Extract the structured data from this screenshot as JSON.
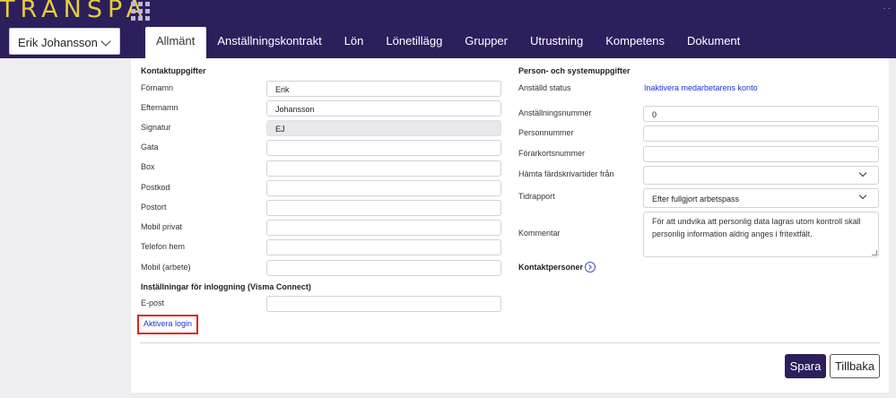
{
  "header": {
    "logo": "TRANSPA",
    "apps_icon": "grid-icon",
    "employee_select": "Erik Johansson"
  },
  "tabs": [
    {
      "label": "Allmänt",
      "active": true
    },
    {
      "label": "Anställningskontrakt"
    },
    {
      "label": "Lön"
    },
    {
      "label": "Lönetillägg"
    },
    {
      "label": "Grupper"
    },
    {
      "label": "Utrustning"
    },
    {
      "label": "Kompetens"
    },
    {
      "label": "Dokument"
    }
  ],
  "contact": {
    "heading": "Kontaktuppgifter",
    "fields": [
      {
        "label": "Förnamn",
        "value": "Erik"
      },
      {
        "label": "Efternamn",
        "value": "Johansson"
      },
      {
        "label": "Signatur",
        "value": "EJ"
      },
      {
        "label": "Gata",
        "value": ""
      },
      {
        "label": "Box",
        "value": ""
      },
      {
        "label": "Postkod",
        "value": ""
      },
      {
        "label": "Postort",
        "value": ""
      },
      {
        "label": "Mobil privat",
        "value": ""
      },
      {
        "label": "Telefon hem",
        "value": ""
      },
      {
        "label": "Mobil (arbete)",
        "value": ""
      }
    ]
  },
  "login": {
    "heading": "Inställningar för inloggning (Visma Connect)",
    "email_label": "E-post",
    "email_value": "",
    "activate_link": "Aktivera login"
  },
  "person": {
    "heading": "Person- och systemuppgifter",
    "status_label": "Anställd status",
    "status_link": "Inaktivera medarbetarens konto",
    "employee_number_label": "Anställningsnummer",
    "employee_number_value": "0",
    "personal_number_label": "Personnummer",
    "personal_number_value": "",
    "license_label": "Förarkortsnummer",
    "license_value": "",
    "tacho_label": "Hämta färdskrivartider från",
    "tacho_value": "",
    "time_report_label": "Tidrapport",
    "time_report_value": "Efter fullgjort arbetspass",
    "comment_label": "Kommentar",
    "comment_text": "För att undvika att personlig data lagras utom kontroll skall personlig information aldrig anges i fritextfält."
  },
  "contacts": {
    "heading": "Kontaktpersoner",
    "icon": "chevron-circle-right-icon"
  },
  "actions": {
    "save": "Spara",
    "back": "Tillbaka"
  },
  "colors": {
    "brand": "#2d1f5c",
    "logo": "#e7cc3e",
    "link": "#1d34d6",
    "highlight": "#e0231f"
  }
}
